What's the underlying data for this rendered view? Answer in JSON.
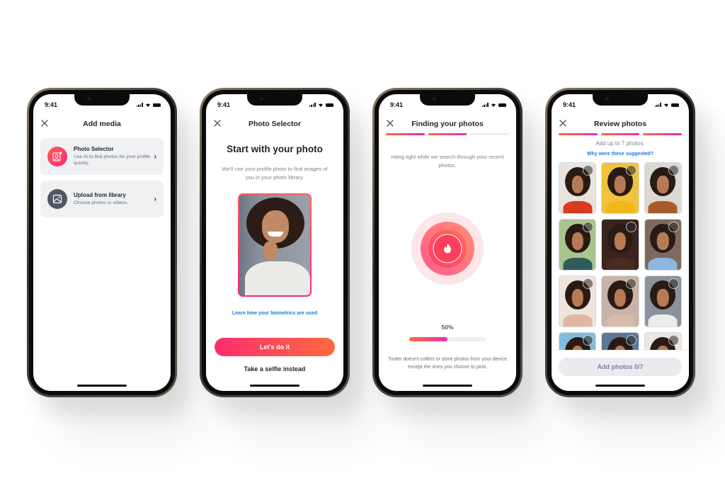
{
  "status_time": "9:41",
  "colors": {
    "brand_gradient_start": "#fd2d6f",
    "brand_gradient_end": "#ff6a3d",
    "progress_pink": "#e52db9",
    "link_blue": "#1f7ae0",
    "card_bg": "#f0f1f3",
    "dark_icon_bg": "#4f5762"
  },
  "screens": [
    {
      "title": "Add media",
      "close_icon": "close-icon",
      "options": [
        {
          "title": "Photo Selector",
          "description": "Use AI to find photos for your profile quickly.",
          "icon": "portrait-plus-icon"
        },
        {
          "title": "Upload from library",
          "description": "Choose photos or videos.",
          "icon": "image-icon"
        }
      ]
    },
    {
      "title": "Photo Selector",
      "heading": "Start with your photo",
      "subtitle": "We'll use your profile photo to find images of you in your photo library.",
      "biometrics_link": "Learn how your biometrics are used",
      "primary_button": "Let's do it",
      "secondary_button": "Take a selfie instead"
    },
    {
      "title": "Finding your photos",
      "steps": [
        true,
        true,
        false
      ],
      "subtitle": "Hang tight while we search through your recent photos.",
      "progress_percent": 50,
      "progress_label": "50%",
      "disclaimer": "Tinder doesn't collect or store photos from your device except the ones you choose to post.",
      "icon": "flame-icon"
    },
    {
      "title": "Review photos",
      "steps": [
        true,
        true,
        true
      ],
      "subtitle": "Add up to 7 photos.",
      "why_link": "Why were these suggested?",
      "photos": [
        {
          "bg": "#e8e3dc",
          "top": "#d63a1f"
        },
        {
          "bg": "#f2c33a",
          "top": "#f2b81c"
        },
        {
          "bg": "#dcd8d2",
          "top": "#a85a2a"
        },
        {
          "bg": "#a9c48d",
          "top": "#2f5c5a"
        },
        {
          "bg": "#3a2420",
          "top": "#4a2a22"
        },
        {
          "bg": "#7d6a5e",
          "top": "#8fb6e0"
        },
        {
          "bg": "#efe4dc",
          "top": "#e2b6a2"
        },
        {
          "bg": "#c7b3a8",
          "top": "#d7bba8"
        },
        {
          "bg": "#8a929c",
          "top": "#ececec"
        },
        {
          "bg": "#7fbde0",
          "top": "#c98a6a"
        },
        {
          "bg": "#5d7896",
          "top": "#c08a6a"
        },
        {
          "bg": "#eae6e2",
          "top": "#b3826a"
        }
      ],
      "add_button": "Add photos 0/7"
    }
  ]
}
